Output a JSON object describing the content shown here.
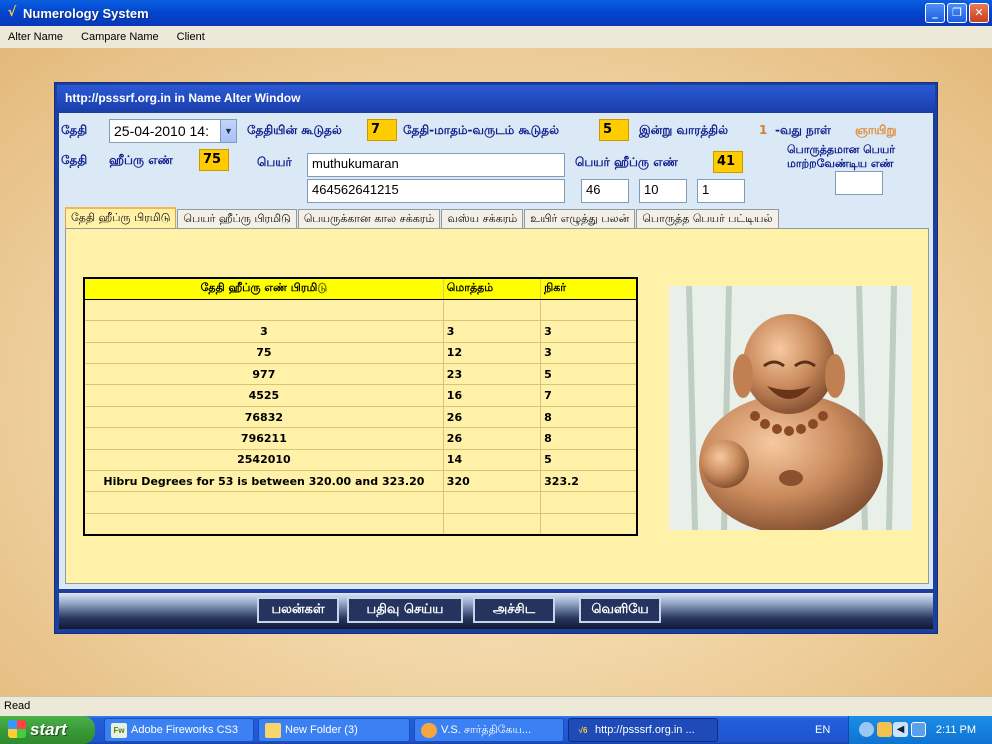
{
  "app": {
    "title": "Numerology System"
  },
  "menu": [
    "Alter Name",
    "Campare Name",
    "Client"
  ],
  "window": {
    "title": "http://psssrf.org.in   in  Name Alter Window"
  },
  "form": {
    "date_label": "தேதி",
    "date_value": "25-04-2010 14:",
    "date_sum_label": "தேதியின் கூடுதல்",
    "date_sum_value": "7",
    "dmy_sum_label": "தேதி-மாதம்-வருடம் கூடுதல்",
    "dmy_sum_value": "5",
    "weekday_label": "இன்று வாரத்தில்",
    "weekday_num": "1",
    "weekday_suffix": "-வது நாள்",
    "weekday_name": "ஞாயிறு",
    "hibru_date_label1": "தேதி",
    "hibru_date_label2": "ஹீப்ரு எண்",
    "hibru_date_value": "75",
    "name_label": "பெயர்",
    "name_value": "muthukumaran",
    "name_digits": "464562641215",
    "name_hibru_label": "பெயர் ஹீப்ரு எண்",
    "name_hibru_value": "41",
    "box1": "46",
    "box2": "10",
    "box3": "1",
    "suitable_label_line1": "பொருத்தமான பெயர்",
    "suitable_label_line2": "மாற்றவேண்டிய எண்",
    "suitable_value": ""
  },
  "tabs": [
    "தேதி ஹீப்ரு பிரமிடு",
    "பெயர் ஹீப்ரு பிரமிடு",
    "பெயருக்கான கால  சக்கரம்",
    "வஸ்ய சக்கரம்",
    "உயிர் எழுத்து பலன்",
    "பொருத்த பெயர் பட்டியல்"
  ],
  "table": {
    "headers": [
      "தேதி   ஹீப்ரு எண் பிரமிடு",
      "மொத்தம்",
      "நிகர்"
    ],
    "rows": [
      [
        "",
        "",
        ""
      ],
      [
        "3",
        "3",
        "3"
      ],
      [
        "75",
        "12",
        "3"
      ],
      [
        "977",
        "23",
        "5"
      ],
      [
        "4525",
        "16",
        "7"
      ],
      [
        "76832",
        "26",
        "8"
      ],
      [
        "796211",
        "26",
        "8"
      ],
      [
        "2542010",
        "14",
        "5"
      ],
      [
        "Hibru Degrees for  53 is between 320.00 and 323.20",
        "320",
        "323.2"
      ],
      [
        "",
        "",
        ""
      ],
      [
        "",
        "",
        ""
      ]
    ]
  },
  "buttons": {
    "results": "பலன்கள்",
    "save": "பதிவு செய்ய",
    "print": "அச்சிட",
    "exit": "வெளியே"
  },
  "status": {
    "text": "Read"
  },
  "taskbar": {
    "start": "start",
    "tasks": [
      "Adobe Fireworks CS3",
      "New Folder (3)",
      "V.S. சார்த்திகேய...",
      "http://psssrf.org.in ..."
    ],
    "task_icons": [
      "Fw",
      "",
      "",
      "√6"
    ],
    "lang": "EN",
    "clock": "2:11 PM"
  },
  "colors": {
    "accent_yellow": "#ffcc00",
    "label_blue": "#10208f",
    "panel_bg": "#fff2a8"
  }
}
